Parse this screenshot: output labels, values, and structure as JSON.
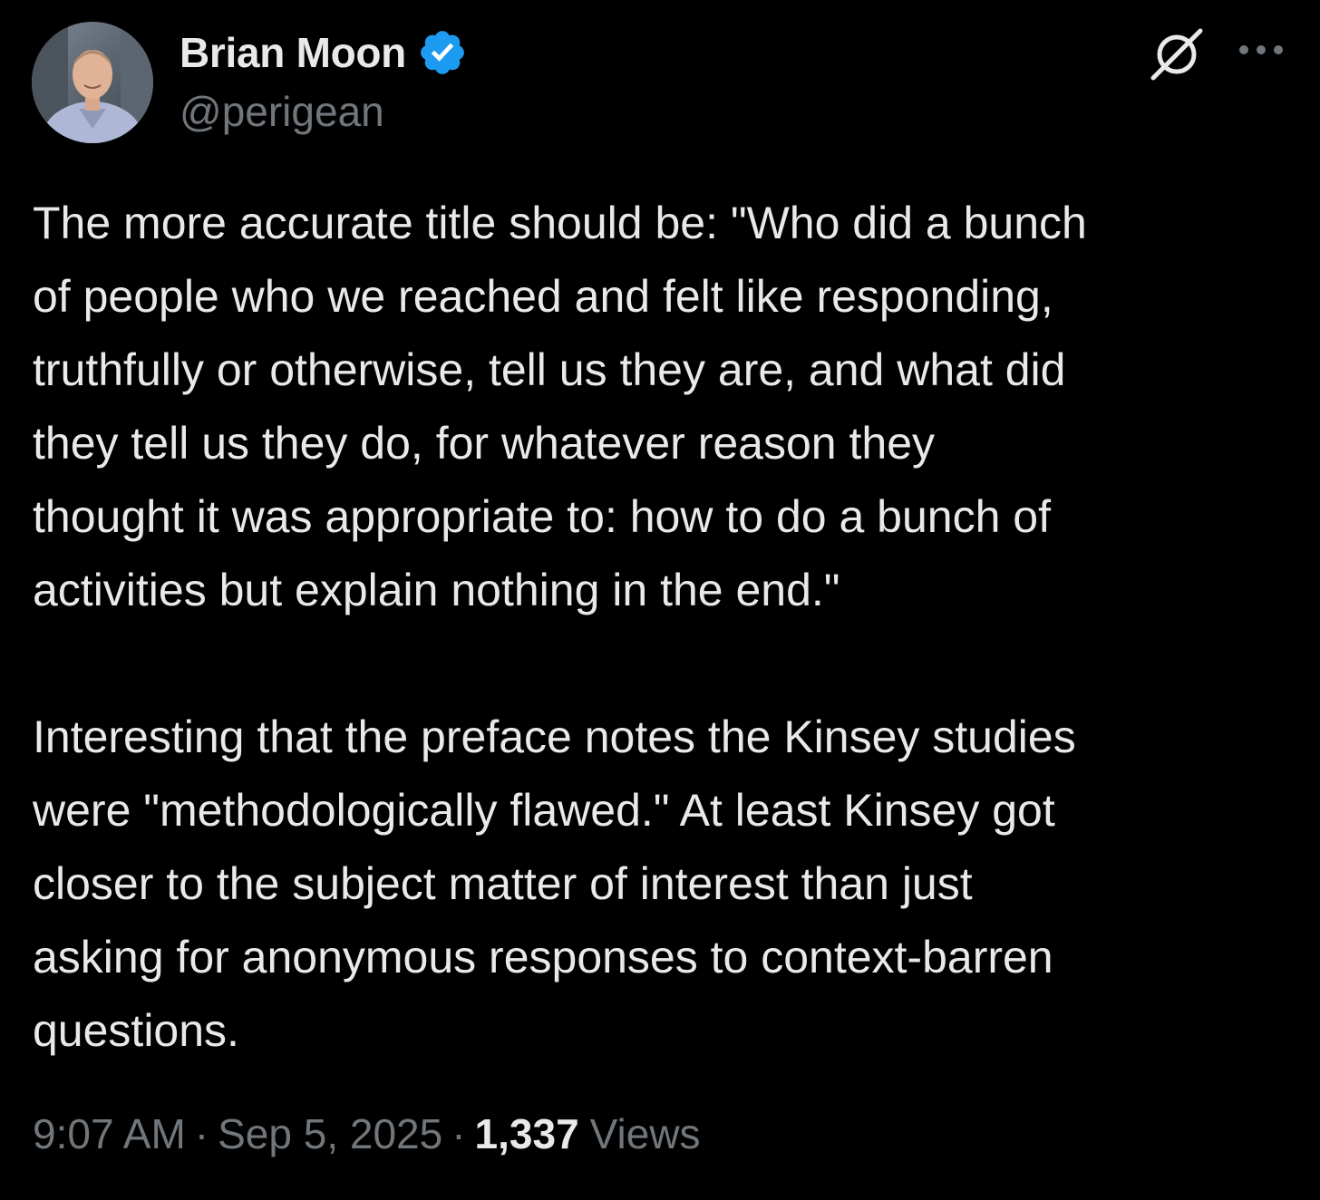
{
  "author": {
    "name": "Brian Moon",
    "handle": "@perigean",
    "verified": true
  },
  "icons": {
    "verified": "verified-badge-icon",
    "grok": "grok-icon",
    "more": "more-options-icon"
  },
  "colors": {
    "background": "#000000",
    "text_primary": "#e7e9ea",
    "text_secondary": "#71767b",
    "verified_blue": "#1d9bf0"
  },
  "tweet": {
    "paragraph1_lines": [
      "The more accurate title should be: \"Who did a bunch",
      "of people who we reached and felt like responding,",
      "truthfully or otherwise, tell us they are, and what did",
      "they tell us they do, for whatever reason they",
      "thought it was appropriate to: how to do a bunch of",
      "activities but explain nothing in the end.\""
    ],
    "paragraph2_lines": [
      "Interesting that the preface notes the Kinsey studies",
      "were \"methodologically flawed.\" At least Kinsey got",
      "closer to the subject matter of interest than just",
      "asking for anonymous responses to context-barren",
      "questions."
    ]
  },
  "meta": {
    "time": "9:07 AM",
    "separator": "·",
    "date": "Sep 5, 2025",
    "views_count": "1,337",
    "views_label": "Views"
  }
}
